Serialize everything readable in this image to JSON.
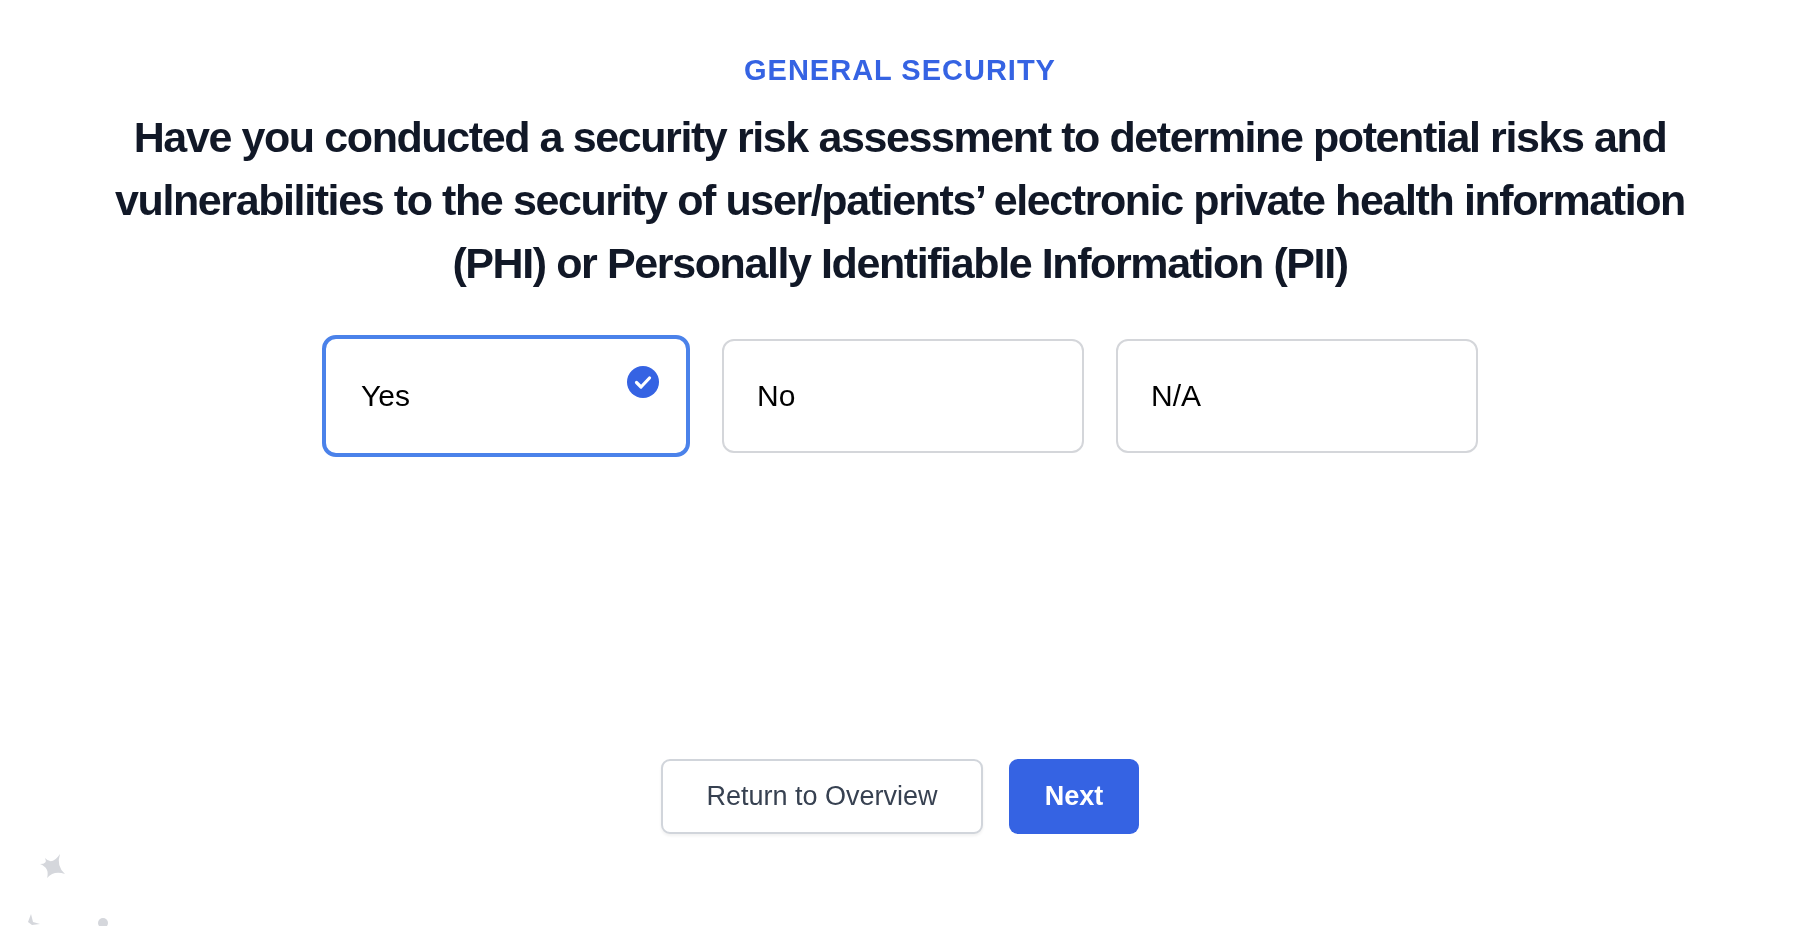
{
  "section": "GENERAL SECURITY",
  "question": "Have you conducted a security risk assessment to determine potential risks and vulnerabilities to the security of user/patients’ electronic private health information (PHI) or Personally Identifiable Information (PII)",
  "options": [
    {
      "label": "Yes",
      "selected": true
    },
    {
      "label": "No",
      "selected": false
    },
    {
      "label": "N/A",
      "selected": false
    }
  ],
  "buttons": [
    {
      "label": "Return to Overview",
      "kind": "secondary"
    },
    {
      "label": "Next",
      "kind": "primary"
    }
  ]
}
